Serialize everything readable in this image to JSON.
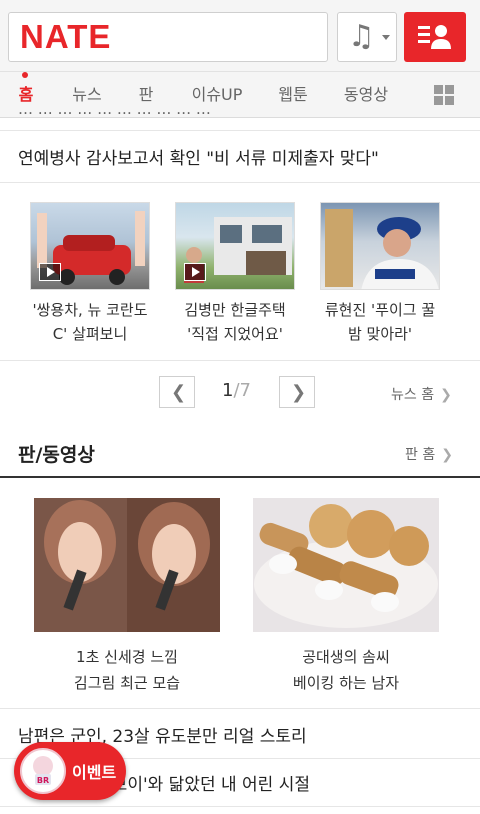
{
  "header": {
    "logo_text": "NATE",
    "music_icon": "music-note-icon",
    "user_icon": "user-menu-icon",
    "accent": "#e8262a"
  },
  "tabs": [
    {
      "label": "홈",
      "active": true
    },
    {
      "label": "뉴스"
    },
    {
      "label": "판"
    },
    {
      "label": "이슈UP"
    },
    {
      "label": "웹툰"
    },
    {
      "label": "동영상"
    }
  ],
  "news": {
    "partial_headline": "… … … … … … … … … …",
    "headline": "연예병사 감사보고서 확인 \"비 서류 미제출자 맞다\"",
    "thumbs": [
      {
        "caption1": "'쌍용차, 뉴 코란도",
        "caption2": "C' 살펴보니"
      },
      {
        "caption1": "김병만 한글주택",
        "caption2": "'직접 지었어요'"
      },
      {
        "caption1": "류현진 '푸이그 꿀",
        "caption2": "밤 맞아라'"
      }
    ],
    "page_current": "1",
    "page_total": "/7",
    "more_label": "뉴스 홈"
  },
  "pan": {
    "section_title": "판/동영상",
    "more_label": "판 홈",
    "cards": [
      {
        "caption1": "1초 신세경 느낌",
        "caption2": "김그림 최근 모습"
      },
      {
        "caption1": "공대생의 솜씨",
        "caption2": "베이킹 하는 남자"
      }
    ],
    "list": [
      "남편은 군인, 23살 유도분만 리얼 스토리",
      "'꼬마 드래곤 보이'와 닮았던 내 어린 시절"
    ]
  },
  "event": {
    "label": "이벤트",
    "badge_text": "BR"
  }
}
